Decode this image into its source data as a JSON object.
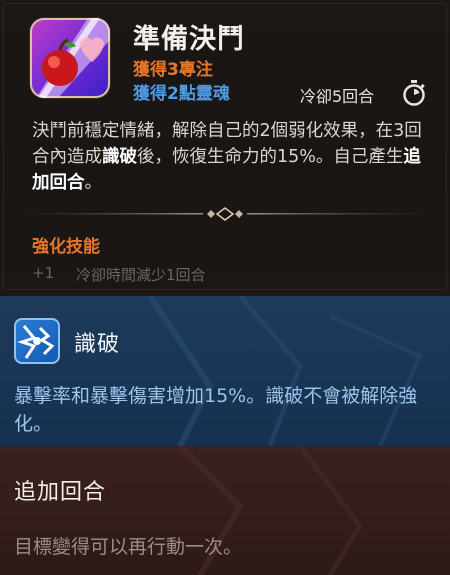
{
  "skill": {
    "name": "準備決鬥",
    "gain_focus": "獲得3專注",
    "gain_soul": "獲得2點靈魂",
    "cooldown": "冷卻5回合",
    "icon": "apple-heart-skill-icon",
    "description": {
      "part1": "決鬥前穩定情緒，解除自己的2個弱化效果，在3回合內造成",
      "highlight1": "識破",
      "part2": "後，恢復生命力的15%。自己產生",
      "highlight2": "追加回合",
      "part3": "。"
    }
  },
  "enhancement": {
    "title": "強化技能",
    "items": [
      {
        "level": "+1",
        "text": "冷卻時間減少1回合"
      }
    ]
  },
  "keywords": [
    {
      "title": "識破",
      "icon": "shatter-icon",
      "text": "暴擊率和暴擊傷害增加15%。識破不會被解除強化。"
    },
    {
      "title": "追加回合",
      "text": "目標變得可以再行動一次。"
    }
  ],
  "colors": {
    "focus": "#e7782a",
    "soul": "#4f9be6",
    "enhance_title": "#e6762c",
    "keyword1_bg": "#1a3757",
    "keyword2_bg": "#341d1d"
  }
}
